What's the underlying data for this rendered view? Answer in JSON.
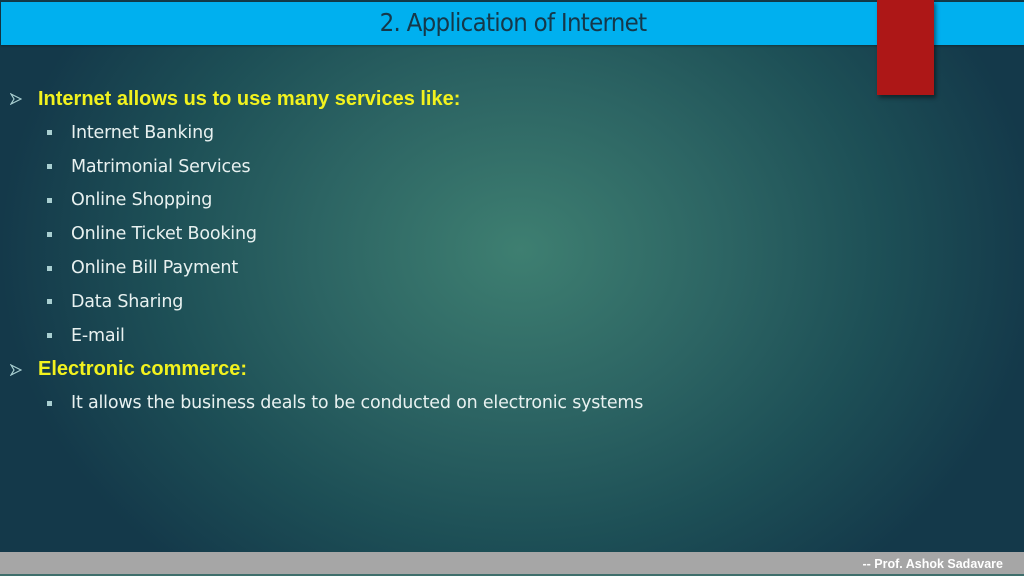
{
  "slide": {
    "title": "2. Application of Internet",
    "colors": {
      "title_bar": "#00b0ef",
      "title_text": "#15384a",
      "accent_square": "#ad1717",
      "heading_text": "#f2f21e",
      "body_text": "#e8f1f0",
      "footer_bar": "#a6a6a6"
    },
    "sections": [
      {
        "icon": "arrowhead-bullet-icon",
        "heading": "Internet allows us to use many services like:",
        "items": [
          {
            "icon": "square-bullet-icon",
            "text": "Internet Banking"
          },
          {
            "icon": "square-bullet-icon",
            "text": "Matrimonial Services"
          },
          {
            "icon": "square-bullet-icon",
            "text": "Online Shopping"
          },
          {
            "icon": "square-bullet-icon",
            "text": "Online Ticket Booking"
          },
          {
            "icon": "square-bullet-icon",
            "text": "Online Bill Payment"
          },
          {
            "icon": "square-bullet-icon",
            "text": "Data Sharing"
          },
          {
            "icon": "square-bullet-icon",
            "text": "E-mail"
          }
        ]
      },
      {
        "icon": "arrowhead-bullet-icon",
        "heading": "Electronic commerce:",
        "items": [
          {
            "icon": "square-bullet-icon",
            "text": "It allows the business deals to be conducted on electronic systems"
          }
        ]
      }
    ],
    "footer": {
      "credit": "-- Prof. Ashok Sadavare"
    }
  }
}
